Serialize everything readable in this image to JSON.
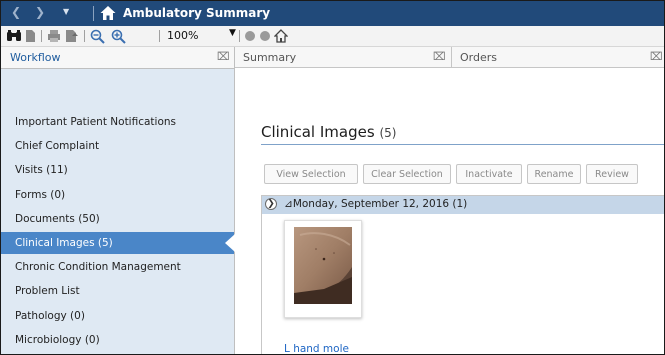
{
  "window": {
    "title": "Ambulatory Summary",
    "nav_icons": [
      "back-arrow-icon",
      "forward-arrow-icon",
      "dropdown-caret-icon",
      "home-icon"
    ]
  },
  "toolbar": {
    "zoom": "100%",
    "icons": [
      "binoculars-icon",
      "document-icon",
      "print-icon",
      "export-icon",
      "zoom-out-icon",
      "zoom-in-icon",
      "circle-icon",
      "circle-icon",
      "home-icon"
    ]
  },
  "tabs": [
    {
      "label": "Workflow"
    },
    {
      "label": "Summary"
    },
    {
      "label": "Orders"
    }
  ],
  "workflow_items": [
    {
      "label": "Important Patient Notifications",
      "active": false
    },
    {
      "label": "Chief Complaint",
      "active": false
    },
    {
      "label": "Visits (11)",
      "active": false
    },
    {
      "label": "Forms (0)",
      "active": false
    },
    {
      "label": "Documents (50)",
      "active": false
    },
    {
      "label": "Clinical Images (5)",
      "active": true
    },
    {
      "label": "Chronic Condition Management",
      "active": false
    },
    {
      "label": "Problem List",
      "active": false
    },
    {
      "label": "Pathology (0)",
      "active": false
    },
    {
      "label": "Microbiology (0)",
      "active": false
    }
  ],
  "clinical_images": {
    "title": "Clinical Images",
    "count": "(5)",
    "buttons": [
      {
        "label": "View Selection"
      },
      {
        "label": "Clear Selection"
      },
      {
        "label": "Inactivate"
      },
      {
        "label": "Rename"
      },
      {
        "label": "Review"
      }
    ],
    "group": {
      "date_label": "Monday, September 12, 2016 (1)",
      "collapse_glyph": "⊿"
    },
    "image_caption": "L hand mole"
  },
  "colors": {
    "titlebar": "#214a7a",
    "active_item": "#4a86c8",
    "link": "#1f66c4",
    "group_header": "#c5d6e8"
  }
}
